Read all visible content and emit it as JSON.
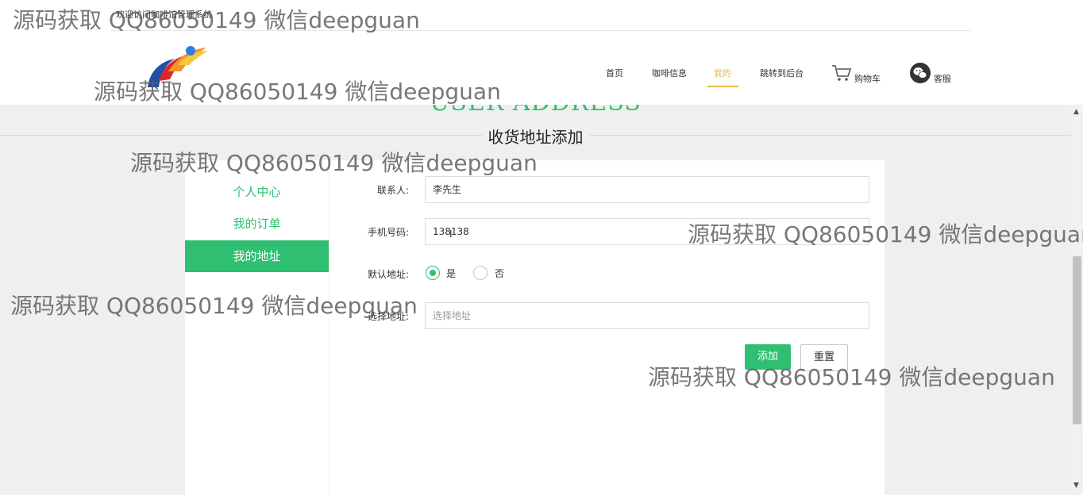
{
  "header": {
    "welcome": "欢迎访问咖啡馆管理系统",
    "nav": {
      "home": "首页",
      "coffee": "咖啡信息",
      "mine": "我的",
      "backend": "跳转到后台",
      "cart": "购物车",
      "service": "客服"
    }
  },
  "section": {
    "en_title": "USER ADDRESS",
    "cn_title": "收货地址添加"
  },
  "sidebar": {
    "items": [
      {
        "label": "个人中心"
      },
      {
        "label": "我的订单"
      },
      {
        "label": "我的地址",
        "active": true
      }
    ]
  },
  "form": {
    "contact_label": "联系人:",
    "contact_value": "李先生",
    "phone_label": "手机号码:",
    "phone_value": "138138",
    "default_label": "默认地址:",
    "default_yes": "是",
    "default_no": "否",
    "default_selected": "是",
    "address_label": "选择地址:",
    "address_placeholder": "选择地址",
    "add_button": "添加",
    "reset_button": "重置"
  },
  "watermark": "源码获取 QQ86050149 微信deepguan",
  "colors": {
    "accent": "#2fbf71",
    "nav_active": "#e8b84a",
    "background": "#efefef"
  },
  "icons": [
    "cart-icon",
    "wechat-icon",
    "logo-icon",
    "scroll-up-icon",
    "scroll-down-icon"
  ]
}
